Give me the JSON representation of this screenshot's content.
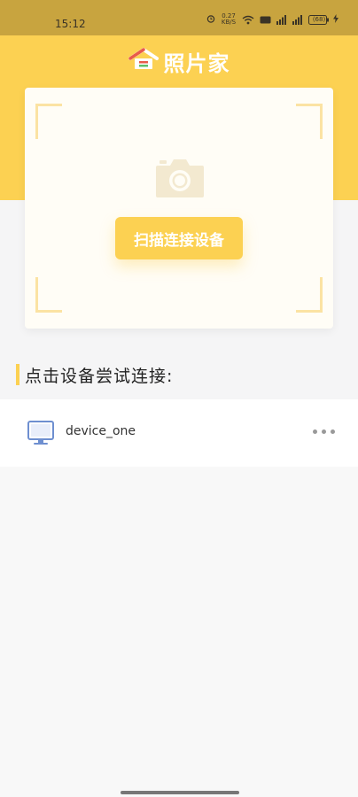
{
  "status_bar": {
    "time": "15:12",
    "net_speed_value": "0.27",
    "net_speed_unit": "KB/S",
    "battery": "(68)"
  },
  "header": {
    "app_title": "照片家",
    "bg_color": "#fcd152"
  },
  "scan": {
    "button_label": "扫描连接设备"
  },
  "devices_section": {
    "title": "点击设备尝试连接:",
    "items": [
      {
        "name": "device_one",
        "icon": "monitor-icon"
      }
    ]
  }
}
